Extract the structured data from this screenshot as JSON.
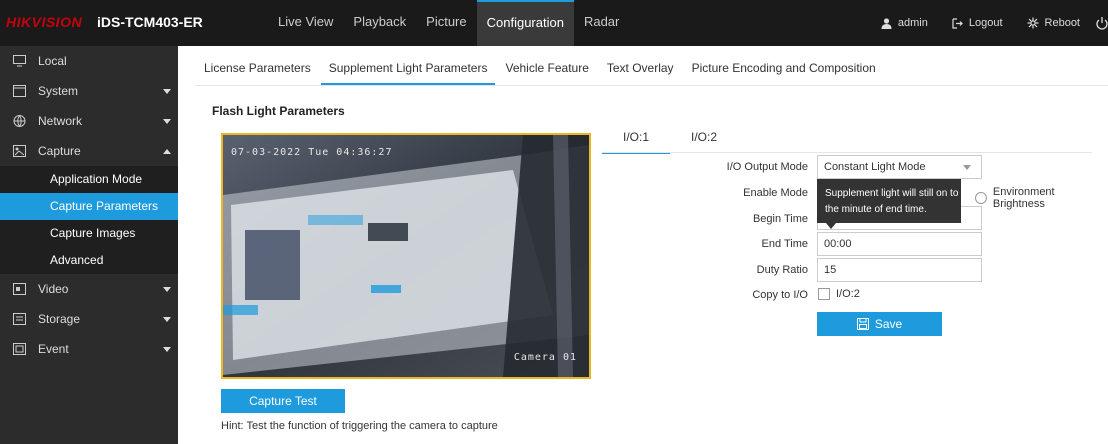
{
  "header": {
    "brand": "HIKVISION",
    "model": "iDS-TCM403-ER",
    "nav": [
      {
        "label": "Live View"
      },
      {
        "label": "Playback"
      },
      {
        "label": "Picture"
      },
      {
        "label": "Configuration"
      },
      {
        "label": "Radar"
      }
    ],
    "user": "admin",
    "logout": "Logout",
    "reboot": "Reboot",
    "accent": "#1e9bdd"
  },
  "sidebar": {
    "items": [
      {
        "label": "Local",
        "icon": "monitor-icon"
      },
      {
        "label": "System",
        "icon": "system-icon"
      },
      {
        "label": "Network",
        "icon": "globe-icon"
      },
      {
        "label": "Capture",
        "icon": "capture-icon"
      }
    ],
    "capture_sub": [
      {
        "label": "Application Mode"
      },
      {
        "label": "Capture Parameters"
      },
      {
        "label": "Capture Images"
      },
      {
        "label": "Advanced"
      }
    ],
    "bottom_items": [
      {
        "label": "Video",
        "icon": "video-icon"
      },
      {
        "label": "Storage",
        "icon": "storage-icon"
      },
      {
        "label": "Event",
        "icon": "event-icon"
      }
    ]
  },
  "main": {
    "tabs": [
      {
        "label": "License Parameters"
      },
      {
        "label": "Supplement Light Parameters"
      },
      {
        "label": "Vehicle Feature"
      },
      {
        "label": "Text Overlay"
      },
      {
        "label": "Picture Encoding and Composition"
      }
    ],
    "section_title": "Flash Light Parameters",
    "video": {
      "timestamp": "07-03-2022 Tue 04:36:27",
      "camera": "Camera 01"
    },
    "capture_test": "Capture Test",
    "hint": "Hint: Test the function of triggering the camera to capture",
    "io_tabs": [
      {
        "label": "I/O:1"
      },
      {
        "label": "I/O:2"
      }
    ],
    "form": {
      "io_output_mode_label": "I/O Output Mode",
      "io_output_mode_value": "Constant Light Mode",
      "enable_mode_label": "Enable Mode",
      "environment_brightness": "Environment Brightness",
      "begin_time_label": "Begin Time",
      "end_time_label": "End Time",
      "end_time_value": "00:00",
      "duty_ratio_label": "Duty Ratio",
      "duty_ratio_value": "15",
      "copy_to_io_label": "Copy to I/O",
      "copy_io2": "I/O:2",
      "save": "Save"
    },
    "tooltip": {
      "line1": "Supplement light will still on to",
      "line2": "the minute of end time."
    }
  }
}
